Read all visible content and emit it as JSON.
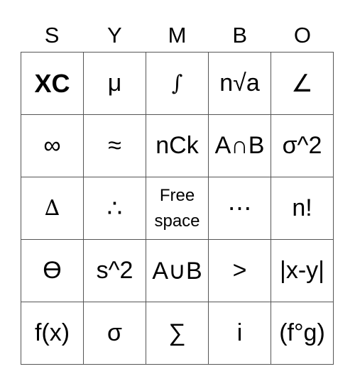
{
  "header": [
    "S",
    "Y",
    "M",
    "B",
    "O"
  ],
  "cells": [
    [
      "XC",
      "μ",
      "∫",
      "n√a",
      "∠"
    ],
    [
      "∞",
      "≈",
      "nCk",
      "A∩B",
      "σ^2"
    ],
    [
      "∆",
      "∴",
      "Free space",
      "⋯",
      "n!"
    ],
    [
      "ϴ",
      "s^2",
      "A∪B",
      ">",
      "|x-y|"
    ],
    [
      "f(x)",
      "σ",
      "∑",
      "i",
      "(f°g)"
    ]
  ]
}
